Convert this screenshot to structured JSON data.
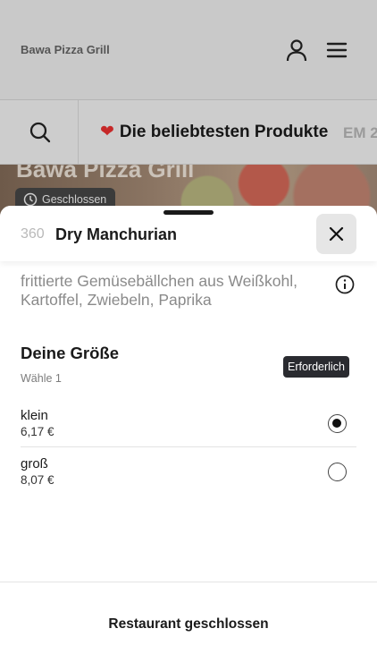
{
  "header": {
    "brand": "Bawa Pizza Grill",
    "user_icon": "user-icon",
    "menu_icon": "hamburger-menu-icon"
  },
  "nav": {
    "search_icon": "search-icon",
    "active_category": "Die beliebtesten Produkte",
    "active_category_icon": "heart-icon",
    "next_category": "EM 2"
  },
  "hero": {
    "title": "Bawa Pizza Grill",
    "status": "Geschlossen",
    "status_icon": "clock-icon"
  },
  "sheet": {
    "item_number": "360",
    "item_name": "Dry Manchurian",
    "close_icon": "close-icon",
    "description": "frittierte Gemüsebällchen aus Weißkohl, Kartoffel, Zwiebeln, Paprika",
    "info_icon": "info-icon",
    "option_group": {
      "title": "Deine Größe",
      "subtitle": "Wähle 1",
      "required_badge": "Erforderlich",
      "options": [
        {
          "label": "klein",
          "price": "6,17 €",
          "selected": true
        },
        {
          "label": "groß",
          "price": "8,07 €",
          "selected": false
        }
      ]
    },
    "footer_button": "Restaurant geschlossen"
  }
}
